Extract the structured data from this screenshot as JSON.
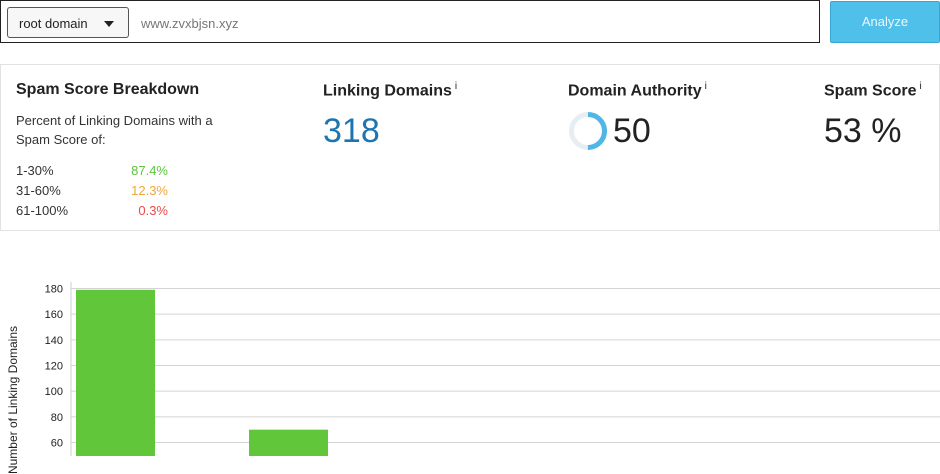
{
  "search": {
    "scope_selected": "root domain",
    "url_value": "www.zvxbjsn.xyz",
    "analyze_label": "Analyze"
  },
  "breakdown": {
    "title": "Spam Score Breakdown",
    "description": "Percent of Linking Domains with a Spam Score of:",
    "rows": [
      {
        "range": "1-30%",
        "pct": "87.4%"
      },
      {
        "range": "31-60%",
        "pct": "12.3%"
      },
      {
        "range": "61-100%",
        "pct": "0.3%"
      }
    ],
    "colors": {
      "low": "#5cc53c",
      "mid": "#f0a63a",
      "high": "#e84b4b"
    }
  },
  "linking_domains": {
    "title": "Linking Domains",
    "info": "i",
    "value": "318",
    "color": "#1c75b0"
  },
  "domain_authority": {
    "title": "Domain Authority",
    "info": "i",
    "value": "50",
    "ring_fraction": 0.5,
    "ring_color": "#4fb6e6"
  },
  "spam_score": {
    "title": "Spam Score",
    "info": "i",
    "value": "53 %"
  },
  "chart_data": {
    "type": "bar",
    "ylabel": "Number of Linking Domains",
    "yticks": [
      60,
      80,
      100,
      120,
      140,
      160,
      180
    ],
    "ylim_visible": [
      51,
      187
    ],
    "bars": [
      {
        "value": 179,
        "color": "#62c63b"
      },
      {
        "value": 70,
        "color": "#62c63b"
      }
    ],
    "grid": true
  }
}
